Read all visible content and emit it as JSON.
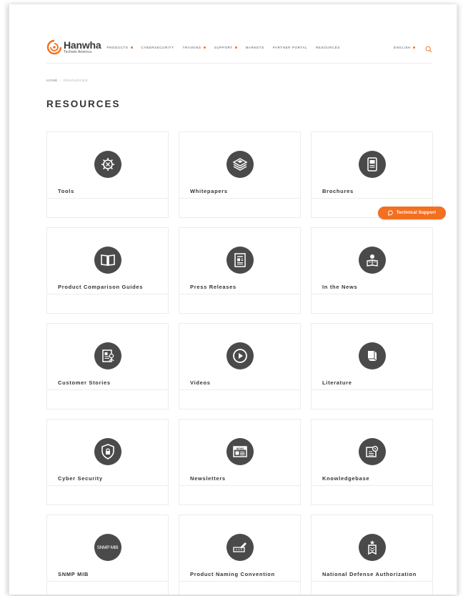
{
  "brand": {
    "name": "Hanwha",
    "sub": "Techwin America",
    "accent_color": "#f37021"
  },
  "nav": {
    "items": [
      {
        "label": "PRODUCTS",
        "dropdown": true
      },
      {
        "label": "CYBERSECURITY",
        "dropdown": false
      },
      {
        "label": "TRAINING",
        "dropdown": true
      },
      {
        "label": "SUPPORT",
        "dropdown": true
      },
      {
        "label": "MARKETS",
        "dropdown": false
      },
      {
        "label": "PARTNER PORTAL",
        "dropdown": false
      },
      {
        "label": "RESOURCES",
        "dropdown": false
      }
    ],
    "language": "ENGLISH"
  },
  "breadcrumb": {
    "home": "HOME",
    "separator": "›",
    "current": "RESOURCES"
  },
  "page_title": "RESOURCES",
  "tech_support": {
    "label": "Technical Support"
  },
  "cards": [
    {
      "label": "Tools",
      "icon": "gear-tools-icon"
    },
    {
      "label": "Whitepapers",
      "icon": "stacked-papers-icon"
    },
    {
      "label": "Brochures",
      "icon": "brochure-icon"
    },
    {
      "label": "Product Comparison Guides",
      "icon": "open-book-icon"
    },
    {
      "label": "Press Releases",
      "icon": "newspaper-icon"
    },
    {
      "label": "In the News",
      "icon": "person-reading-icon"
    },
    {
      "label": "Customer Stories",
      "icon": "document-person-icon"
    },
    {
      "label": "Videos",
      "icon": "play-icon"
    },
    {
      "label": "Literature",
      "icon": "book-icon"
    },
    {
      "label": "Cyber Security",
      "icon": "shield-lock-icon"
    },
    {
      "label": "Newsletters",
      "icon": "news-icon"
    },
    {
      "label": "Knowledgebase",
      "icon": "book-gear-icon"
    },
    {
      "label": "SNMP MIB",
      "icon_text": "SNMP MIB",
      "icon": "snmp-mib-icon"
    },
    {
      "label": "Product Naming Convention",
      "icon": "naming-pencil-icon"
    },
    {
      "label": "National Defense Authorization",
      "icon": "ndaa-badge-icon"
    }
  ]
}
